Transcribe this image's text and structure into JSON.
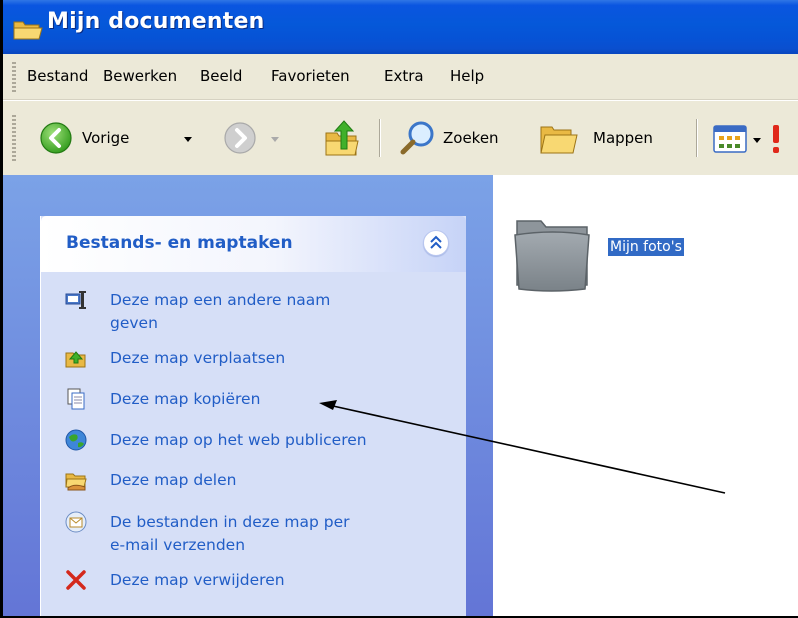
{
  "window": {
    "title": "Mijn documenten"
  },
  "menu": {
    "items": [
      "Bestand",
      "Bewerken",
      "Beeld",
      "Favorieten",
      "Extra",
      "Help"
    ]
  },
  "toolbar": {
    "back_label": "Vorige",
    "search_label": "Zoeken",
    "folders_label": "Mappen"
  },
  "taskpane": {
    "title": "Bestands- en maptaken",
    "tasks": [
      {
        "icon": "rename-icon",
        "lines": [
          "Deze map een andere naam",
          "geven"
        ]
      },
      {
        "icon": "move-folder-icon",
        "lines": [
          "Deze map verplaatsen"
        ]
      },
      {
        "icon": "copy-folder-icon",
        "lines": [
          "Deze map kopiëren"
        ]
      },
      {
        "icon": "publish-web-icon",
        "lines": [
          "Deze map op het web publiceren"
        ]
      },
      {
        "icon": "share-folder-icon",
        "lines": [
          "Deze map delen"
        ]
      },
      {
        "icon": "email-icon",
        "lines": [
          "De bestanden in deze map per",
          "e-mail verzenden"
        ]
      },
      {
        "icon": "delete-icon",
        "lines": [
          "Deze map verwijderen"
        ]
      }
    ]
  },
  "content": {
    "items": [
      {
        "name": "Mijn foto's",
        "selected": true
      }
    ]
  },
  "colors": {
    "titlebar": "#0558d9",
    "link": "#215dc6",
    "taskpane_bg": "#d6dff7",
    "selection": "#316ac5"
  }
}
